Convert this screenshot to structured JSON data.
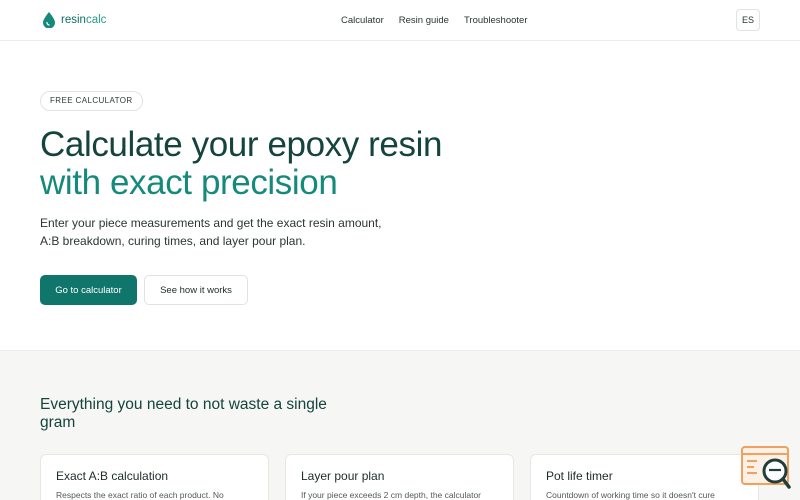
{
  "header": {
    "logo": {
      "part1": "resin",
      "part2": "calc"
    },
    "nav": [
      {
        "label": "Calculator"
      },
      {
        "label": "Resin guide"
      },
      {
        "label": "Troubleshooter"
      }
    ],
    "language": "ES"
  },
  "hero": {
    "badge": "FREE CALCULATOR",
    "title_line1": "Calculate your epoxy resin",
    "title_line2": "with exact precision",
    "subtitle_line1": "Enter your piece measurements and get the exact resin amount,",
    "subtitle_line2": "A:B breakdown, curing times, and layer pour plan.",
    "primary_button": "Go to calculator",
    "secondary_button": "See how it works"
  },
  "features": {
    "title": "Everything you need to not waste a single gram",
    "cards": [
      {
        "title": "Exact A:B calculation",
        "desc": "Respects the exact ratio of each product. No"
      },
      {
        "title": "Layer pour plan",
        "desc": "If your piece exceeds 2 cm depth, the calculator"
      },
      {
        "title": "Pot life timer",
        "desc": "Countdown of working time so it doesn't cure"
      }
    ]
  },
  "colors": {
    "brand": "#10756a",
    "title_dark": "#14443d",
    "title_accent": "#168a7a",
    "widget_orange": "#f0a060"
  },
  "icons": {
    "logo": "droplet-icon",
    "widget": "search-chat-widget-icon"
  }
}
